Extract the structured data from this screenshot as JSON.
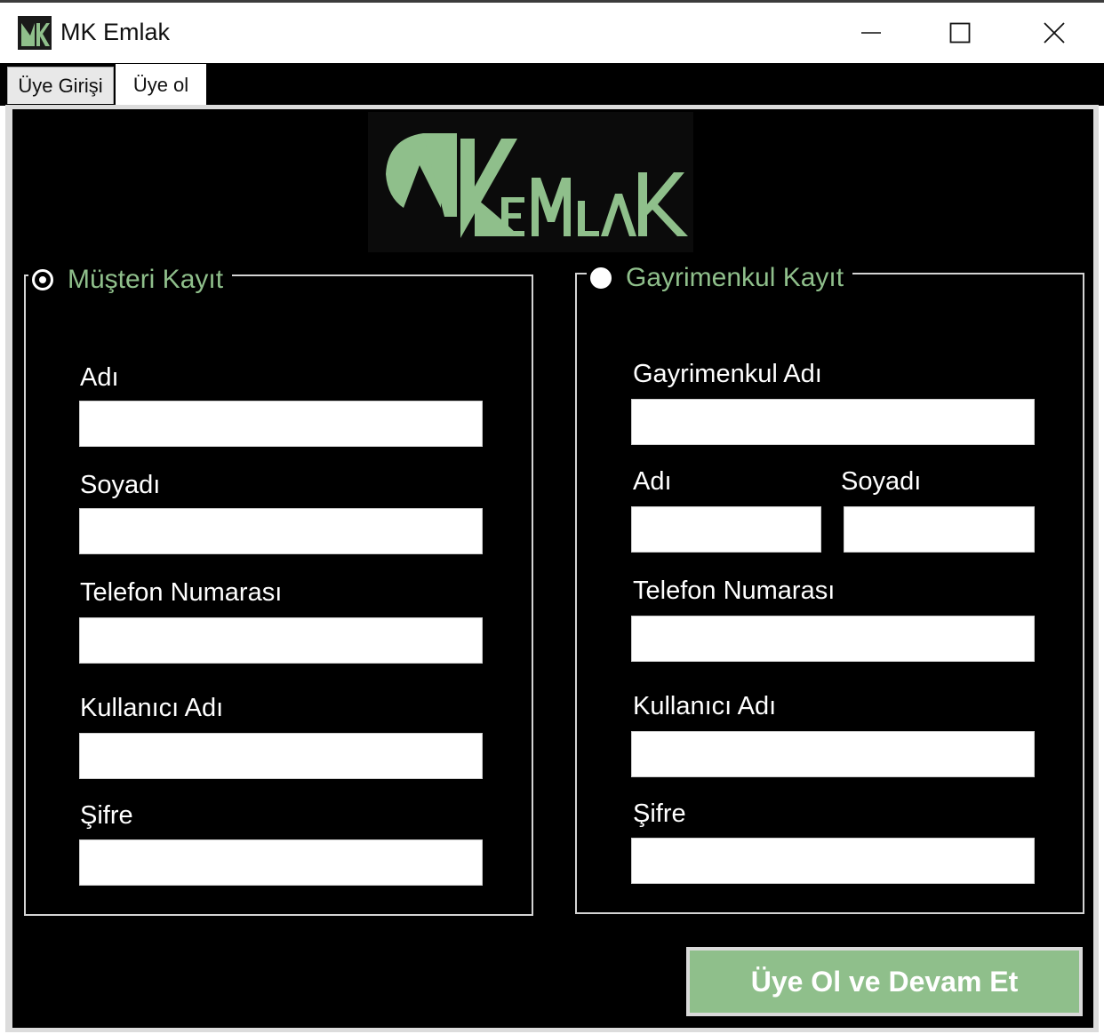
{
  "window": {
    "title": "MK Emlak",
    "app_icon": "mk-logo-icon",
    "controls": {
      "minimize": "minimize-icon",
      "maximize": "maximize-icon",
      "close": "close-icon"
    }
  },
  "tabs": [
    {
      "label": "Üye Girişi",
      "selected": false
    },
    {
      "label": "Üye ol",
      "selected": true
    }
  ],
  "logo": {
    "text": "MKEMLAK",
    "color": "#8fbf8b"
  },
  "customer_group": {
    "title": "Müşteri Kayıt",
    "selected": true,
    "fields": [
      {
        "label": "Adı",
        "value": ""
      },
      {
        "label": "Soyadı",
        "value": ""
      },
      {
        "label": "Telefon Numarası",
        "value": ""
      },
      {
        "label": "Kullanıcı Adı",
        "value": ""
      },
      {
        "label": "Şifre",
        "value": ""
      }
    ]
  },
  "property_group": {
    "title": "Gayrimenkul Kayıt",
    "selected": false,
    "fields": {
      "property_name": {
        "label": "Gayrimenkul Adı",
        "value": ""
      },
      "first_name": {
        "label": "Adı",
        "value": ""
      },
      "last_name": {
        "label": "Soyadı",
        "value": ""
      },
      "phone": {
        "label": "Telefon Numarası",
        "value": ""
      },
      "username": {
        "label": "Kullanıcı Adı",
        "value": ""
      },
      "password": {
        "label": "Şifre",
        "value": ""
      }
    }
  },
  "submit": {
    "label": "Üye Ol ve Devam Et"
  },
  "colors": {
    "accent": "#8fbf8b",
    "background": "#000000",
    "text": "#ffffff"
  }
}
